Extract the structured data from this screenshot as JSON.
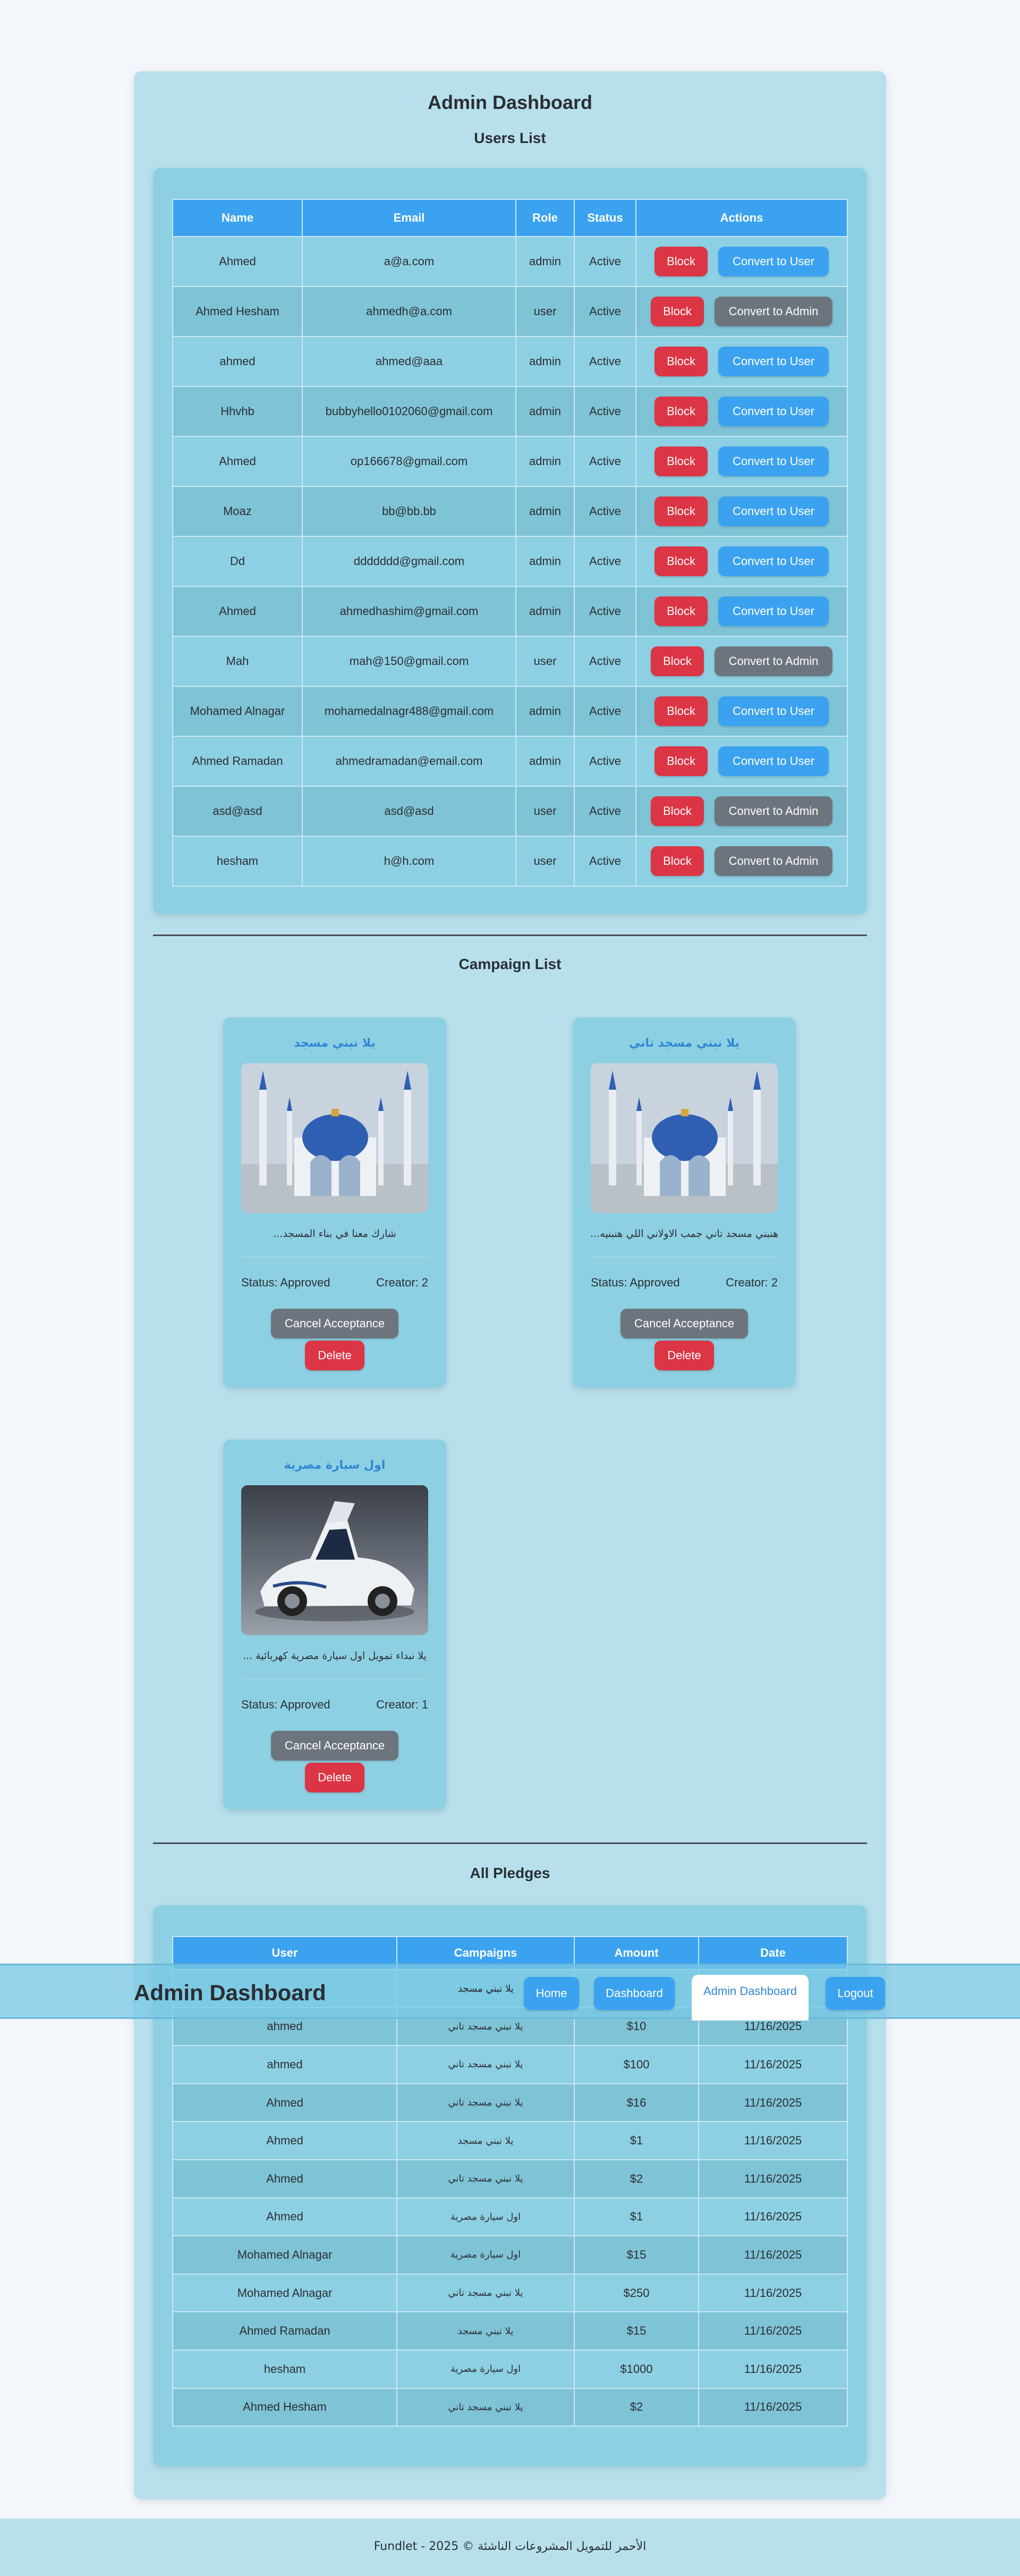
{
  "header": {
    "title": "Admin Dashboard"
  },
  "users": {
    "title": "Users List",
    "columns": [
      "Name",
      "Email",
      "Role",
      "Status",
      "Actions"
    ],
    "block_label": "Block",
    "rows": [
      {
        "name": "Ahmed",
        "email": "a@a.com",
        "role": "admin",
        "status": "Active",
        "convert": "Convert to User"
      },
      {
        "name": "Ahmed Hesham",
        "email": "ahmedh@a.com",
        "role": "user",
        "status": "Active",
        "convert": "Convert to Admin"
      },
      {
        "name": "ahmed",
        "email": "ahmed@aaa",
        "role": "admin",
        "status": "Active",
        "convert": "Convert to User"
      },
      {
        "name": "Hhvhb",
        "email": "bubbyhello0102060@gmail.com",
        "role": "admin",
        "status": "Active",
        "convert": "Convert to User"
      },
      {
        "name": "Ahmed",
        "email": "op166678@gmail.com",
        "role": "admin",
        "status": "Active",
        "convert": "Convert to User"
      },
      {
        "name": "Moaz",
        "email": "bb@bb.bb",
        "role": "admin",
        "status": "Active",
        "convert": "Convert to User"
      },
      {
        "name": "Dd",
        "email": "ddddddd@gmail.com",
        "role": "admin",
        "status": "Active",
        "convert": "Convert to User"
      },
      {
        "name": "Ahmed",
        "email": "ahmedhashim@gmail.com",
        "role": "admin",
        "status": "Active",
        "convert": "Convert to User"
      },
      {
        "name": "Mah",
        "email": "mah@150@gmail.com",
        "role": "user",
        "status": "Active",
        "convert": "Convert to Admin"
      },
      {
        "name": "Mohamed Alnagar",
        "email": "mohamedalnagr488@gmail.com",
        "role": "admin",
        "status": "Active",
        "convert": "Convert to User"
      },
      {
        "name": "Ahmed Ramadan",
        "email": "ahmedramadan@email.com",
        "role": "admin",
        "status": "Active",
        "convert": "Convert to User"
      },
      {
        "name": "asd@asd",
        "email": "asd@asd",
        "role": "user",
        "status": "Active",
        "convert": "Convert to Admin"
      },
      {
        "name": "hesham",
        "email": "h@h.com",
        "role": "user",
        "status": "Active",
        "convert": "Convert to Admin"
      }
    ]
  },
  "campaigns": {
    "title": "Campaign List",
    "cancel_label": "Cancel Acceptance",
    "delete_label": "Delete",
    "items": [
      {
        "title": "يلا نبني مسجد",
        "desc": "...شارك معنا في بناء المسجد",
        "status": "Status: Approved",
        "creator": "Creator: 2",
        "image": "mosque-image"
      },
      {
        "title": "يلا نبني مسجد تاني",
        "desc": "...هنبني مسجد تاني جمب الاولاني اللي هنبنيه",
        "status": "Status: Approved",
        "creator": "Creator: 2",
        "image": "mosque-image"
      },
      {
        "title": "اول سيارة مصرية",
        "desc": "... يلا نبداء تمويل اول سيارة مصرية كهربائية",
        "status": "Status: Approved",
        "creator": "Creator: 1",
        "image": "car-image"
      }
    ]
  },
  "pledges": {
    "title": "All Pledges",
    "columns": [
      "User",
      "Campaigns",
      "Amount",
      "Date"
    ],
    "rows": [
      {
        "user": "",
        "campaign": "يلا نبني مسجد",
        "amount": "",
        "date": ""
      },
      {
        "user": "ahmed",
        "campaign": "يلا نبني مسجد تاني",
        "amount": "$10",
        "date": "11/16/2025"
      },
      {
        "user": "ahmed",
        "campaign": "يلا نبني مسجد تاني",
        "amount": "$100",
        "date": "11/16/2025"
      },
      {
        "user": "Ahmed",
        "campaign": "يلا نبني مسجد تاني",
        "amount": "$16",
        "date": "11/16/2025"
      },
      {
        "user": "Ahmed",
        "campaign": "يلا نبني مسجد",
        "amount": "$1",
        "date": "11/16/2025"
      },
      {
        "user": "Ahmed",
        "campaign": "يلا نبني مسجد تاني",
        "amount": "$2",
        "date": "11/16/2025"
      },
      {
        "user": "Ahmed",
        "campaign": "اول سيارة مصرية",
        "amount": "$1",
        "date": "11/16/2025"
      },
      {
        "user": "Mohamed Alnagar",
        "campaign": "اول سيارة مصرية",
        "amount": "$15",
        "date": "11/16/2025"
      },
      {
        "user": "Mohamed Alnagar",
        "campaign": "يلا نبني مسجد تاني",
        "amount": "$250",
        "date": "11/16/2025"
      },
      {
        "user": "Ahmed Ramadan",
        "campaign": "يلا نبني مسجد",
        "amount": "$15",
        "date": "11/16/2025"
      },
      {
        "user": "hesham",
        "campaign": "اول سيارة مصرية",
        "amount": "$1000",
        "date": "11/16/2025"
      },
      {
        "user": "Ahmed Hesham",
        "campaign": "يلا نبني مسجد تاني",
        "amount": "$2",
        "date": "11/16/2025"
      }
    ]
  },
  "navbar": {
    "brand": "Admin Dashboard",
    "items": [
      {
        "label": "Home",
        "active": false
      },
      {
        "label": "Dashboard",
        "active": false
      },
      {
        "label": "Admin Dashboard",
        "active": true
      },
      {
        "label": "Logout",
        "active": false
      }
    ]
  },
  "footer": {
    "text": "Fundlet - 2025 © الأحمر للتمويل المشروعات الناشئة"
  },
  "colors": {
    "primary": "#3ba2f0",
    "danger": "#dc3545",
    "secondary": "#6c757d",
    "panel": "#8dd0e3",
    "page": "#b7e0ec"
  }
}
